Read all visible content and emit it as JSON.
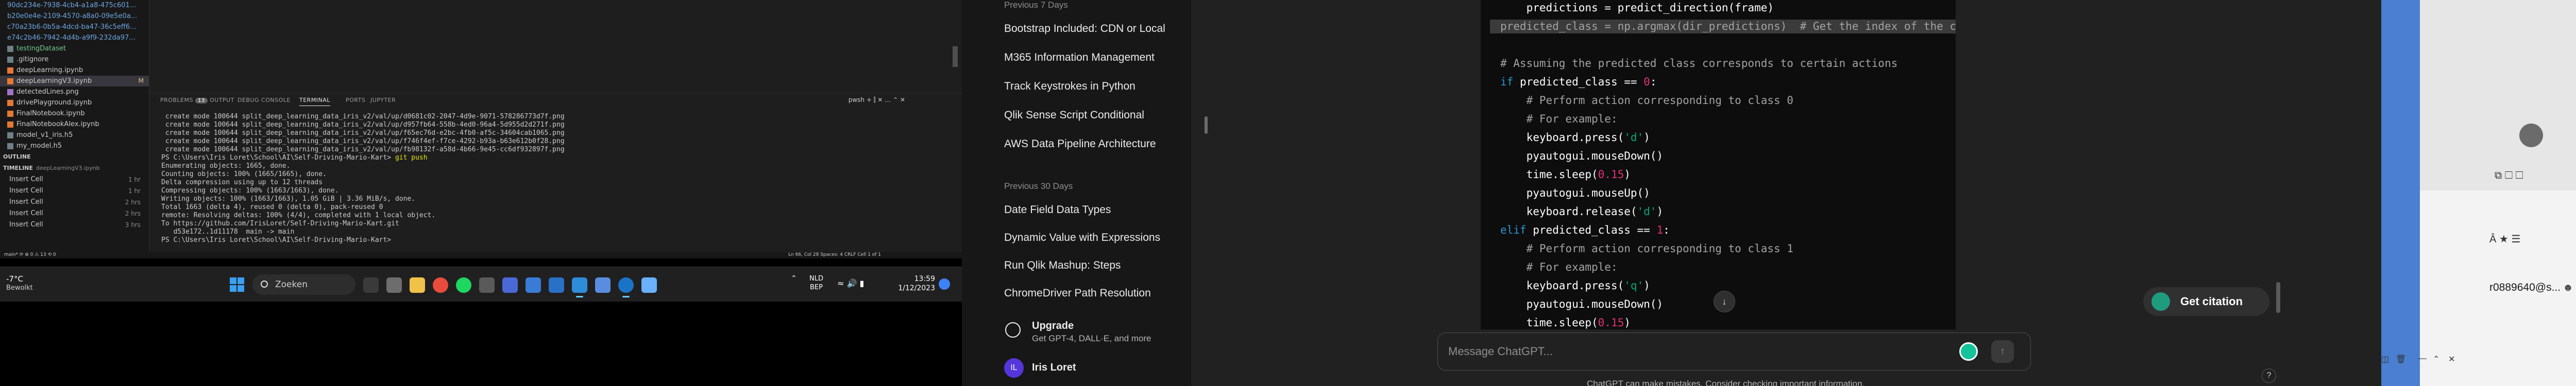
{
  "vscode": {
    "explorer": {
      "git_files": [
        {
          "name": "90dc234e-7938-4cb4-a1a8-475c601...",
          "badge": "U"
        },
        {
          "name": "b20e0e4e-2109-4570-a8a0-09e5e0a...",
          "badge": "U"
        },
        {
          "name": "c70a23b6-0b5a-4dcd-ba47-36c5eff6...",
          "badge": "U"
        },
        {
          "name": "e74c2b46-7942-4d4b-a9f9-232da97...",
          "badge": "U"
        }
      ],
      "files": [
        {
          "name": "testingDataset",
          "cls": "green",
          "badge": ""
        },
        {
          "name": ".gitignore",
          "cls": "",
          "badge": ""
        },
        {
          "name": "deepLearning.ipynb",
          "cls": "",
          "badge": ""
        },
        {
          "name": "deepLearningV3.ipynb",
          "cls": "sel",
          "badge": "M"
        },
        {
          "name": "detectedLines.png",
          "cls": "",
          "badge": ""
        },
        {
          "name": "drivePlayground.ipynb",
          "cls": "",
          "badge": ""
        },
        {
          "name": "FinalNotebook.ipynb",
          "cls": "",
          "badge": ""
        },
        {
          "name": "FinalNotebookAlex.ipynb",
          "cls": "",
          "badge": ""
        },
        {
          "name": "model_v1_iris.h5",
          "cls": "",
          "badge": ""
        },
        {
          "name": "my_model.h5",
          "cls": "",
          "badge": ""
        }
      ],
      "outline_label": "OUTLINE",
      "timeline_label": "TIMELINE",
      "timeline_file": "deepLearningV3.ipynb",
      "timeline_items": [
        {
          "label": "Insert Cell",
          "when": "1 hr"
        },
        {
          "label": "Insert Cell",
          "when": "1 hr"
        },
        {
          "label": "Insert Cell",
          "when": "2 hrs"
        },
        {
          "label": "Insert Cell",
          "when": "2 hrs"
        },
        {
          "label": "Insert Cell",
          "when": "3 hrs"
        }
      ]
    },
    "panel": {
      "tabs": [
        {
          "label": "PROBLEMS",
          "count": "13"
        },
        {
          "label": "OUTPUT",
          "count": ""
        },
        {
          "label": "DEBUG CONSOLE",
          "count": ""
        },
        {
          "label": "TERMINAL",
          "count": ""
        },
        {
          "label": "PORTS",
          "count": ""
        },
        {
          "label": "JUPYTER",
          "count": ""
        }
      ],
      "shell_label": "pwsh"
    },
    "terminal_lines": [
      " create mode 100644 split_deep_learning_data_iris_v2/val/up/d0681c02-2047-4d9e-9071-578286773d7f.png",
      " create mode 100644 split_deep_learning_data_iris_v2/val/up/d957fb64-558b-4ed0-96a4-5d955d2d271f.png",
      " create mode 100644 split_deep_learning_data_iris_v2/val/up/f65ec76d-e2bc-4fb0-af5c-34604cab1065.png",
      " create mode 100644 split_deep_learning_data_iris_v2/val/up/f746f4ef-f7ce-4292-b93a-b63e612b0f28.png",
      " create mode 100644 split_deep_learning_data_iris_v2/val/up/fb98132f-a58d-4b66-9e45-cc6df932897f.png"
    ],
    "prompt_path": "PS C:\\Users\\Iris Loret\\School\\AI\\Self-Driving-Mario-Kart>",
    "prompt_cmd": " git push",
    "push_output": [
      "Enumerating objects: 1665, done.",
      "Counting objects: 100% (1665/1665), done.",
      "Delta compression using up to 12 threads",
      "Compressing objects: 100% (1663/1663), done.",
      "Writing objects: 100% (1663/1663), 1.05 GiB | 3.36 MiB/s, done.",
      "Total 1663 (delta 4), reused 0 (delta 0), pack-reused 0",
      "remote: Resolving deltas: 100% (4/4), completed with 1 local object.",
      "To https://github.com/IrisLoret/Self-Driving-Mario-Kart.git",
      "   d53e172..1d11178  main -> main"
    ],
    "final_prompt": "PS C:\\Users\\Iris Loret\\School\\AI\\Self-Driving-Mario-Kart> ",
    "statusbar": {
      "left": "main* ⟳ ⊗ 0 ⚠ 13 ⟲ 0",
      "right": "Ln 66, Col 28   Spaces: 4   CRLF   Cell 1 of 1"
    }
  },
  "taskbar": {
    "weather_temp": "-7°C",
    "weather_desc": "Bewolkt",
    "search_placeholder": "Zoeken",
    "lang_top": "NLD",
    "lang_bottom": "BEP",
    "time": "13:59",
    "date": "1/12/2023"
  },
  "chatgpt": {
    "sidebar": {
      "section_7": "Previous 7 Days",
      "items_7": [
        "Bootstrap Included: CDN or Local",
        "M365 Information Management",
        "Track Keystrokes in Python",
        "Qlik Sense Script Conditional",
        "AWS Data Pipeline Architecture"
      ],
      "section_30": "Previous 30 Days",
      "items_30": [
        "Date Field Data Types",
        "Dynamic Value with Expressions",
        "Run Qlik Mashup: Steps",
        "ChromeDriver Path Resolution"
      ],
      "upgrade_title": "Upgrade",
      "upgrade_sub": "Get GPT-4, DALL·E, and more",
      "avatar_initials": "IL",
      "user_name": "Iris Loret"
    },
    "code_lines": [
      {
        "cls": "",
        "segs": [
          {
            "t": "    predictions = predict_direction(frame)",
            "c": ""
          }
        ]
      },
      {
        "cls": "hl",
        "segs": [
          {
            "t": "predicted_class = np.argmax(dir_predictions)  # Get the index of the cl",
            "c": "c-com"
          }
        ]
      },
      {
        "cls": "",
        "segs": [
          {
            "t": "",
            "c": ""
          }
        ]
      },
      {
        "cls": "",
        "segs": [
          {
            "t": "# Assuming the predicted class corresponds to certain actions",
            "c": "c-com"
          }
        ]
      },
      {
        "cls": "",
        "segs": [
          {
            "t": "if",
            "c": "c-kw"
          },
          {
            "t": " predicted_class == ",
            "c": ""
          },
          {
            "t": "0",
            "c": "c-num"
          },
          {
            "t": ":",
            "c": ""
          }
        ]
      },
      {
        "cls": "",
        "segs": [
          {
            "t": "    # Perform action corresponding to class 0",
            "c": "c-com"
          }
        ]
      },
      {
        "cls": "",
        "segs": [
          {
            "t": "    # For example:",
            "c": "c-com"
          }
        ]
      },
      {
        "cls": "",
        "segs": [
          {
            "t": "    keyboard.press(",
            "c": ""
          },
          {
            "t": "'d'",
            "c": "c-str"
          },
          {
            "t": ")",
            "c": ""
          }
        ]
      },
      {
        "cls": "",
        "segs": [
          {
            "t": "    pyautogui.mouseDown()",
            "c": ""
          }
        ]
      },
      {
        "cls": "",
        "segs": [
          {
            "t": "    time.sleep(",
            "c": ""
          },
          {
            "t": "0.15",
            "c": "c-num"
          },
          {
            "t": ")",
            "c": ""
          }
        ]
      },
      {
        "cls": "",
        "segs": [
          {
            "t": "    pyautogui.mouseUp()",
            "c": ""
          }
        ]
      },
      {
        "cls": "",
        "segs": [
          {
            "t": "    keyboard.release(",
            "c": ""
          },
          {
            "t": "'d'",
            "c": "c-str"
          },
          {
            "t": ")",
            "c": ""
          }
        ]
      },
      {
        "cls": "",
        "segs": [
          {
            "t": "elif",
            "c": "c-kw"
          },
          {
            "t": " predicted_class == ",
            "c": ""
          },
          {
            "t": "1",
            "c": "c-num"
          },
          {
            "t": ":",
            "c": ""
          }
        ]
      },
      {
        "cls": "",
        "segs": [
          {
            "t": "    # Perform action corresponding to class 1",
            "c": "c-com"
          }
        ]
      },
      {
        "cls": "",
        "segs": [
          {
            "t": "    # For example:",
            "c": "c-com"
          }
        ]
      },
      {
        "cls": "",
        "segs": [
          {
            "t": "    keyboard.press(",
            "c": ""
          },
          {
            "t": "'q'",
            "c": "c-str"
          },
          {
            "t": ")",
            "c": ""
          }
        ]
      },
      {
        "cls": "",
        "segs": [
          {
            "t": "    pyautogui.mouseDown()",
            "c": ""
          }
        ]
      },
      {
        "cls": "",
        "segs": [
          {
            "t": "    time.sleep(",
            "c": ""
          },
          {
            "t": "0.15",
            "c": "c-num"
          },
          {
            "t": ")",
            "c": ""
          }
        ]
      }
    ],
    "composer_placeholder": "Message ChatGPT...",
    "disclaimer": "ChatGPT can make mistakes. Consider checking important information.",
    "help_label": "?",
    "scroll_down_label": "↓",
    "send_label": "↑",
    "citation_label": "Get citation"
  },
  "edge_browser": {
    "email": "r0889640@s...",
    "row_text": "⧉  ☐  ☐",
    "row2_text": "Â   ★   ☰"
  }
}
